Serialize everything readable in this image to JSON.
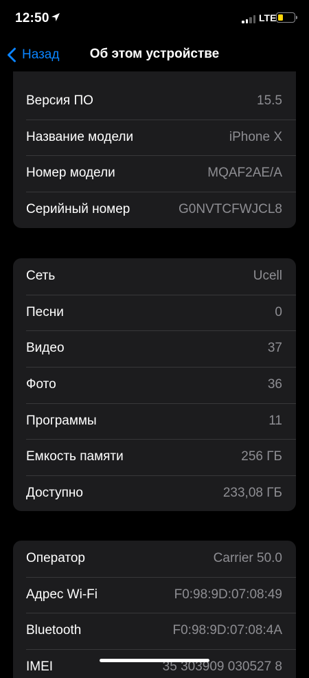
{
  "status_bar": {
    "time": "12:50",
    "network": "LTE",
    "signal_bars_active": 2,
    "signal_bars_total": 4,
    "battery_level": 0.3,
    "battery_color": "#ffd60a"
  },
  "nav": {
    "back_label": "Назад",
    "title": "Об этом устройстве",
    "accent_color": "#0a84ff"
  },
  "group1": {
    "rows": [
      {
        "label": "Версия ПО",
        "value": "15.5"
      },
      {
        "label": "Название модели",
        "value": "iPhone X"
      },
      {
        "label": "Номер модели",
        "value": "MQAF2AE/A"
      },
      {
        "label": "Серийный номер",
        "value": "G0NVTCFWJCL8"
      }
    ]
  },
  "group2": {
    "rows": [
      {
        "label": "Сеть",
        "value": "Ucell"
      },
      {
        "label": "Песни",
        "value": "0"
      },
      {
        "label": "Видео",
        "value": "37"
      },
      {
        "label": "Фото",
        "value": "36"
      },
      {
        "label": "Программы",
        "value": "11"
      },
      {
        "label": "Емкость памяти",
        "value": "256 ГБ"
      },
      {
        "label": "Доступно",
        "value": "233,08 ГБ"
      }
    ]
  },
  "group3": {
    "rows": [
      {
        "label": "Оператор",
        "value": "Carrier 50.0"
      },
      {
        "label": "Адрес Wi-Fi",
        "value": "F0:98:9D:07:08:49"
      },
      {
        "label": "Bluetooth",
        "value": "F0:98:9D:07:08:4A"
      },
      {
        "label": "IMEI",
        "value": "35 303909 030527 8"
      }
    ]
  }
}
